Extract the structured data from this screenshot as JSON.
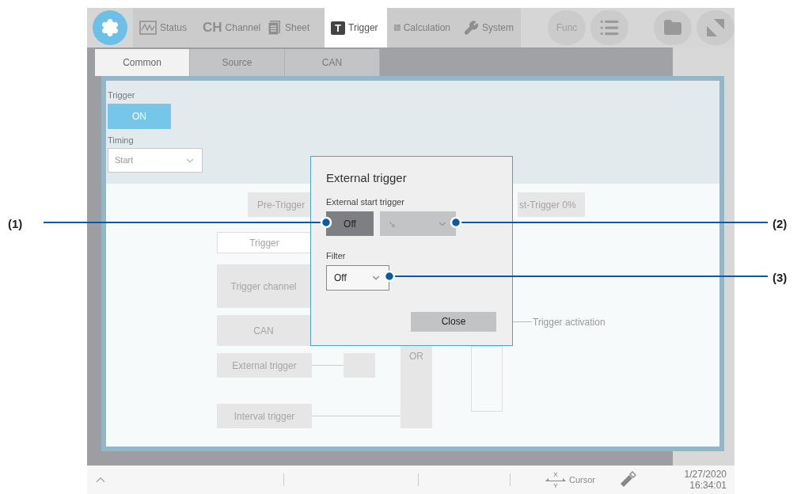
{
  "callouts": [
    {
      "label": "(1)"
    },
    {
      "label": "(2)"
    },
    {
      "label": "(3)"
    }
  ],
  "top_tabs": [
    {
      "label": "Status",
      "kind": "wave",
      "selected": false
    },
    {
      "label": "Channel",
      "kind": "text",
      "icon_text": "CH",
      "selected": false
    },
    {
      "label": "Sheet",
      "kind": "sheet",
      "selected": false
    },
    {
      "label": "Trigger",
      "kind": "text-box",
      "icon_text": "T",
      "selected": true
    },
    {
      "label": "Calculation",
      "kind": "calc",
      "selected": false
    },
    {
      "label": "System",
      "kind": "wrench",
      "selected": false
    }
  ],
  "func_button": "Func",
  "sub_tabs": [
    {
      "label": "Common",
      "selected": true
    },
    {
      "label": "Source",
      "selected": false
    },
    {
      "label": "CAN",
      "selected": false
    }
  ],
  "settings": {
    "trigger_label": "Trigger",
    "trigger_toggle": {
      "label": "ON",
      "on": true
    },
    "timing_label": "Timing",
    "timing_value": "Start"
  },
  "diagram": {
    "pre_trigger": "Pre-Trigger",
    "post_trigger": "st-Trigger 0%",
    "trigger": "Trigger",
    "trigger_channel": "Trigger channel",
    "can": "CAN",
    "external_trigger": "External trigger",
    "interval_trigger": "Interval trigger",
    "or_label": "OR",
    "activation": "Trigger activation"
  },
  "dialog": {
    "title": "External trigger",
    "start_label": "External start trigger",
    "start_button": "Off",
    "slope": {
      "value": "↘",
      "disabled": true
    },
    "filter_label": "Filter",
    "filter_value": "Off",
    "close": "Close"
  },
  "status_bar": {
    "cursor_x": "X",
    "cursor_y": "Y",
    "cursor_label": "Cursor",
    "date": "1/27/2020",
    "time": "16:34:01"
  }
}
